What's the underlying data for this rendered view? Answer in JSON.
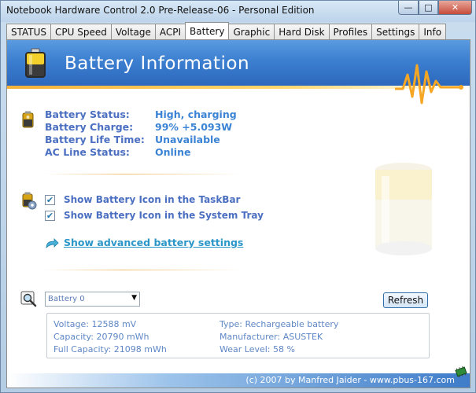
{
  "window": {
    "title": "Notebook Hardware Control 2.0 Pre-Release-06  -  Personal Edition"
  },
  "titlebar_buttons": {
    "minimize": "—",
    "maximize": "□",
    "close": "✕"
  },
  "tabs": [
    {
      "label": "STATUS"
    },
    {
      "label": "CPU Speed"
    },
    {
      "label": "Voltage"
    },
    {
      "label": "ACPI"
    },
    {
      "label": "Battery"
    },
    {
      "label": "Graphic"
    },
    {
      "label": "Hard Disk"
    },
    {
      "label": "Profiles"
    },
    {
      "label": "Settings"
    },
    {
      "label": "Info"
    }
  ],
  "active_tab": "Battery",
  "header": {
    "title": "Battery Information"
  },
  "status": {
    "rows": [
      {
        "label": "Battery Status:",
        "value": "High, charging"
      },
      {
        "label": "Battery Charge:",
        "value": "99%  +5.093W"
      },
      {
        "label": "Battery Life Time:",
        "value": "Unavailable"
      },
      {
        "label": "AC Line Status:",
        "value": "Online"
      }
    ]
  },
  "options": {
    "taskbar_label": "Show Battery Icon in the TaskBar",
    "taskbar_checked": true,
    "tray_label": "Show Battery Icon in the System Tray",
    "tray_checked": true,
    "advanced_link": "Show advanced battery settings"
  },
  "battery_select": {
    "value": "Battery 0"
  },
  "refresh_label": "Refresh",
  "details": {
    "voltage": "Voltage:  12588 mV",
    "capacity": "Capacity:  20790 mWh",
    "full_capacity": "Full Capacity:  21098 mWh",
    "type": "Type:  Rechargeable battery",
    "manufacturer": "Manufacturer:  ASUSTEK",
    "wear_level": "Wear Level:  58 %"
  },
  "footer": {
    "text": "(c) 2007 by Manfred Jaider - www.pbus-167.com"
  },
  "colors": {
    "accent": "#3c7fd0",
    "label": "#4b6fc1",
    "value": "#3b83d4",
    "pulse": "#f5a623"
  }
}
